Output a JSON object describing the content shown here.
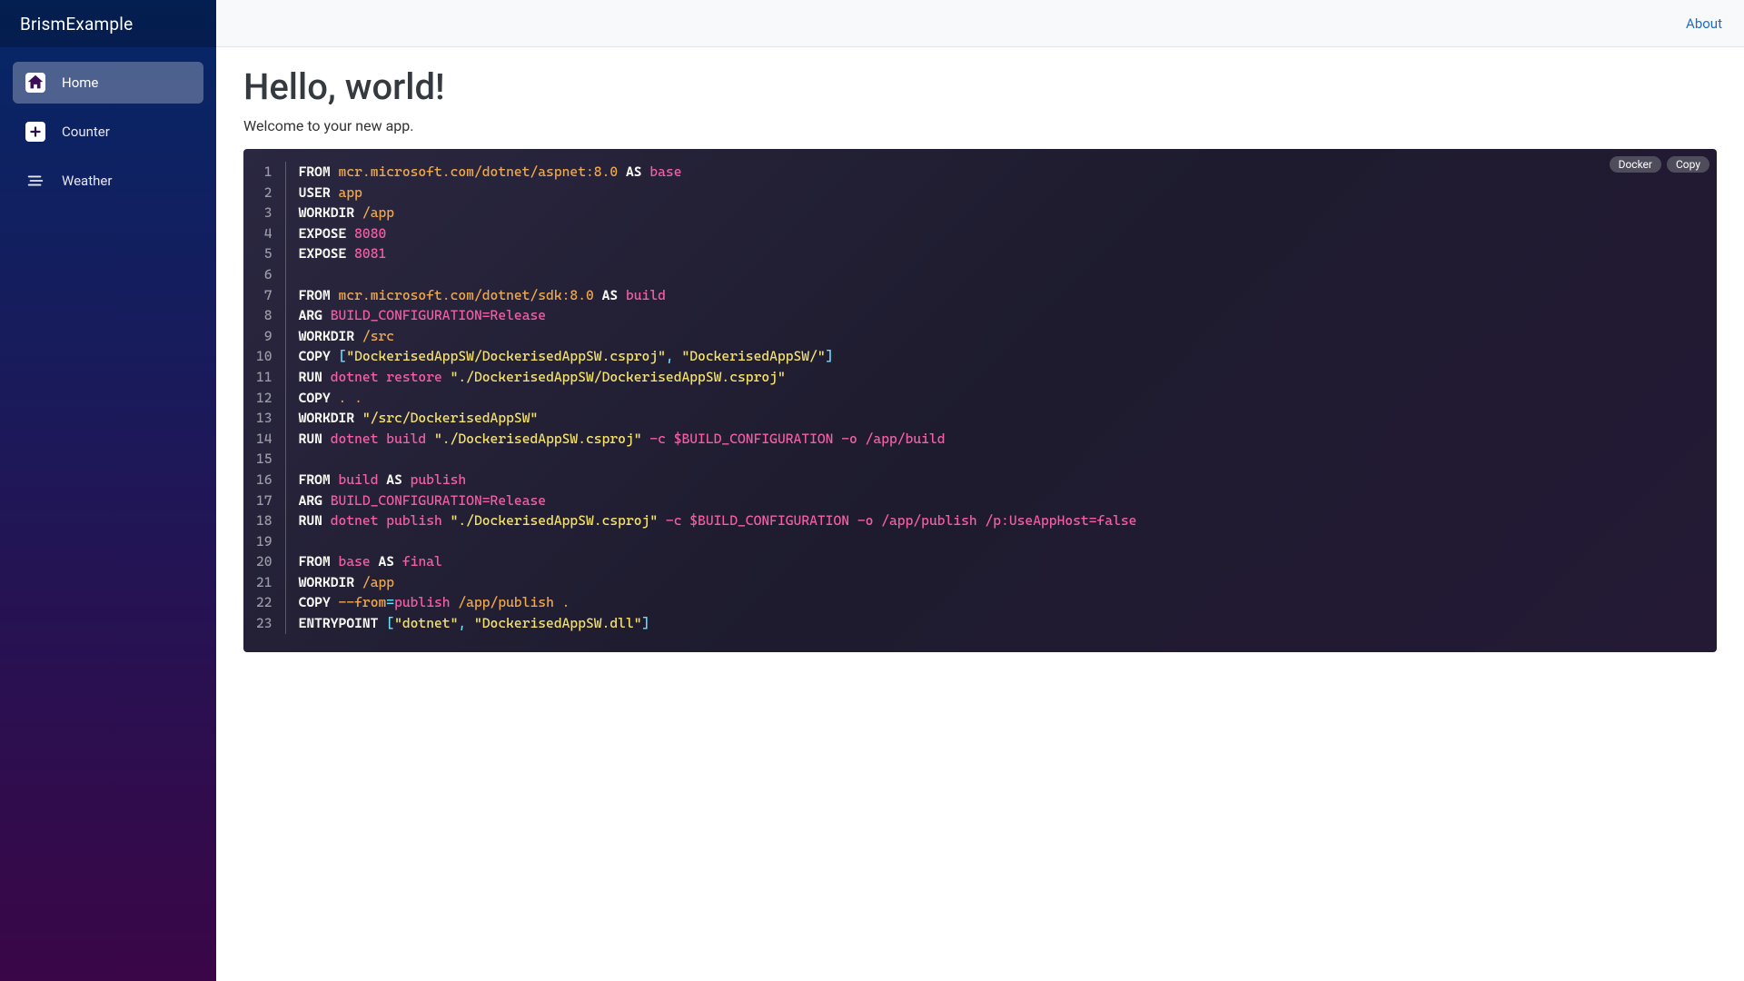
{
  "brand": "BrismExample",
  "topbar": {
    "about": "About"
  },
  "sidebar": {
    "items": [
      {
        "label": "Home"
      },
      {
        "label": "Counter"
      },
      {
        "label": "Weather"
      }
    ]
  },
  "page": {
    "title": "Hello, world!",
    "subtitle": "Welcome to your new app."
  },
  "codeblock": {
    "badge_lang": "Docker",
    "badge_copy": "Copy",
    "line_count": 23,
    "lines": [
      [
        [
          "kw",
          "FROM"
        ],
        [
          "sp",
          " "
        ],
        [
          "img",
          "mcr.microsoft.com/dotnet/aspnet:8.0"
        ],
        [
          "sp",
          " "
        ],
        [
          "kw",
          "AS"
        ],
        [
          "sp",
          " "
        ],
        [
          "name",
          "base"
        ]
      ],
      [
        [
          "kw",
          "USER"
        ],
        [
          "sp",
          " "
        ],
        [
          "img",
          "app"
        ]
      ],
      [
        [
          "kw",
          "WORKDIR"
        ],
        [
          "sp",
          " "
        ],
        [
          "img",
          "/app"
        ]
      ],
      [
        [
          "kw",
          "EXPOSE"
        ],
        [
          "sp",
          " "
        ],
        [
          "name",
          "8080"
        ]
      ],
      [
        [
          "kw",
          "EXPOSE"
        ],
        [
          "sp",
          " "
        ],
        [
          "name",
          "8081"
        ]
      ],
      [],
      [
        [
          "kw",
          "FROM"
        ],
        [
          "sp",
          " "
        ],
        [
          "img",
          "mcr.microsoft.com/dotnet/sdk:8.0"
        ],
        [
          "sp",
          " "
        ],
        [
          "kw",
          "AS"
        ],
        [
          "sp",
          " "
        ],
        [
          "name",
          "build"
        ]
      ],
      [
        [
          "kw",
          "ARG"
        ],
        [
          "sp",
          " "
        ],
        [
          "name",
          "BUILD_CONFIGURATION=Release"
        ]
      ],
      [
        [
          "kw",
          "WORKDIR"
        ],
        [
          "sp",
          " "
        ],
        [
          "img",
          "/src"
        ]
      ],
      [
        [
          "kw",
          "COPY"
        ],
        [
          "sp",
          " "
        ],
        [
          "op",
          "["
        ],
        [
          "str",
          "\"DockerisedAppSW/DockerisedAppSW.csproj\""
        ],
        [
          "op",
          ", "
        ],
        [
          "str",
          "\"DockerisedAppSW/\""
        ],
        [
          "op",
          "]"
        ]
      ],
      [
        [
          "kw",
          "RUN"
        ],
        [
          "sp",
          " "
        ],
        [
          "cmd",
          "dotnet restore "
        ],
        [
          "str",
          "\"./DockerisedAppSW/DockerisedAppSW.csproj\""
        ]
      ],
      [
        [
          "kw",
          "COPY"
        ],
        [
          "sp",
          " "
        ],
        [
          "img",
          ". ."
        ]
      ],
      [
        [
          "kw",
          "WORKDIR"
        ],
        [
          "sp",
          " "
        ],
        [
          "str",
          "\"/src/DockerisedAppSW\""
        ]
      ],
      [
        [
          "kw",
          "RUN"
        ],
        [
          "sp",
          " "
        ],
        [
          "cmd",
          "dotnet build "
        ],
        [
          "str",
          "\"./DockerisedAppSW.csproj\""
        ],
        [
          "cmd",
          " -c $BUILD_CONFIGURATION -o /app/build"
        ]
      ],
      [],
      [
        [
          "kw",
          "FROM"
        ],
        [
          "sp",
          " "
        ],
        [
          "name",
          "build"
        ],
        [
          "sp",
          " "
        ],
        [
          "kw",
          "AS"
        ],
        [
          "sp",
          " "
        ],
        [
          "name",
          "publish"
        ]
      ],
      [
        [
          "kw",
          "ARG"
        ],
        [
          "sp",
          " "
        ],
        [
          "name",
          "BUILD_CONFIGURATION=Release"
        ]
      ],
      [
        [
          "kw",
          "RUN"
        ],
        [
          "sp",
          " "
        ],
        [
          "cmd",
          "dotnet publish "
        ],
        [
          "str",
          "\"./DockerisedAppSW.csproj\""
        ],
        [
          "cmd",
          " -c $BUILD_CONFIGURATION -o /app/publish /p:UseAppHost=false"
        ]
      ],
      [],
      [
        [
          "kw",
          "FROM"
        ],
        [
          "sp",
          " "
        ],
        [
          "name",
          "base"
        ],
        [
          "sp",
          " "
        ],
        [
          "kw",
          "AS"
        ],
        [
          "sp",
          " "
        ],
        [
          "name",
          "final"
        ]
      ],
      [
        [
          "kw",
          "WORKDIR"
        ],
        [
          "sp",
          " "
        ],
        [
          "img",
          "/app"
        ]
      ],
      [
        [
          "kw",
          "COPY"
        ],
        [
          "sp",
          " "
        ],
        [
          "img",
          "--from"
        ],
        [
          "op",
          "="
        ],
        [
          "name",
          "publish"
        ],
        [
          "sp",
          " "
        ],
        [
          "img",
          "/app/publish ."
        ]
      ],
      [
        [
          "kw",
          "ENTRYPOINT"
        ],
        [
          "sp",
          " "
        ],
        [
          "op",
          "["
        ],
        [
          "str",
          "\"dotnet\""
        ],
        [
          "op",
          ", "
        ],
        [
          "str",
          "\"DockerisedAppSW.dll\""
        ],
        [
          "op",
          "]"
        ]
      ]
    ]
  }
}
